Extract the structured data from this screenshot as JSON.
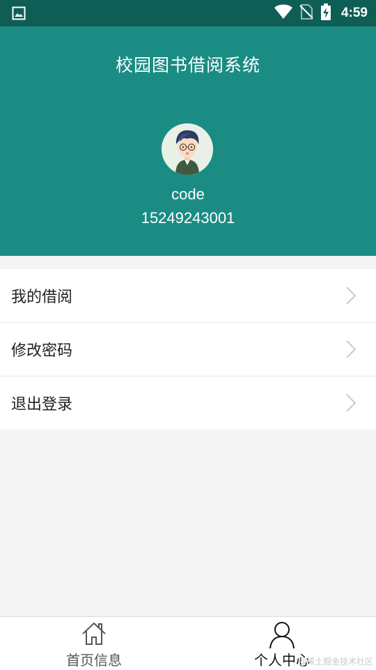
{
  "status_bar": {
    "time": "4:59",
    "icons": [
      "gallery-icon",
      "wifi-icon",
      "no-sim-icon",
      "battery-charging-icon"
    ]
  },
  "header": {
    "title": "校园图书借阅系统",
    "avatar": "user-avatar",
    "username": "code",
    "phone": "15249243001"
  },
  "menu": {
    "items": [
      {
        "label": "我的借阅",
        "icon": "chevron-right-icon"
      },
      {
        "label": "修改密码",
        "icon": "chevron-right-icon"
      },
      {
        "label": "退出登录",
        "icon": "chevron-right-icon"
      }
    ]
  },
  "bottom_nav": {
    "tabs": [
      {
        "label": "首页信息",
        "icon": "home-icon",
        "active": false
      },
      {
        "label": "个人中心",
        "icon": "person-icon",
        "active": true
      }
    ]
  },
  "watermark": "@稀土掘金技术社区",
  "colors": {
    "status_bar": "#0f5e55",
    "header": "#1a8c84",
    "background": "#f4f4f4"
  }
}
